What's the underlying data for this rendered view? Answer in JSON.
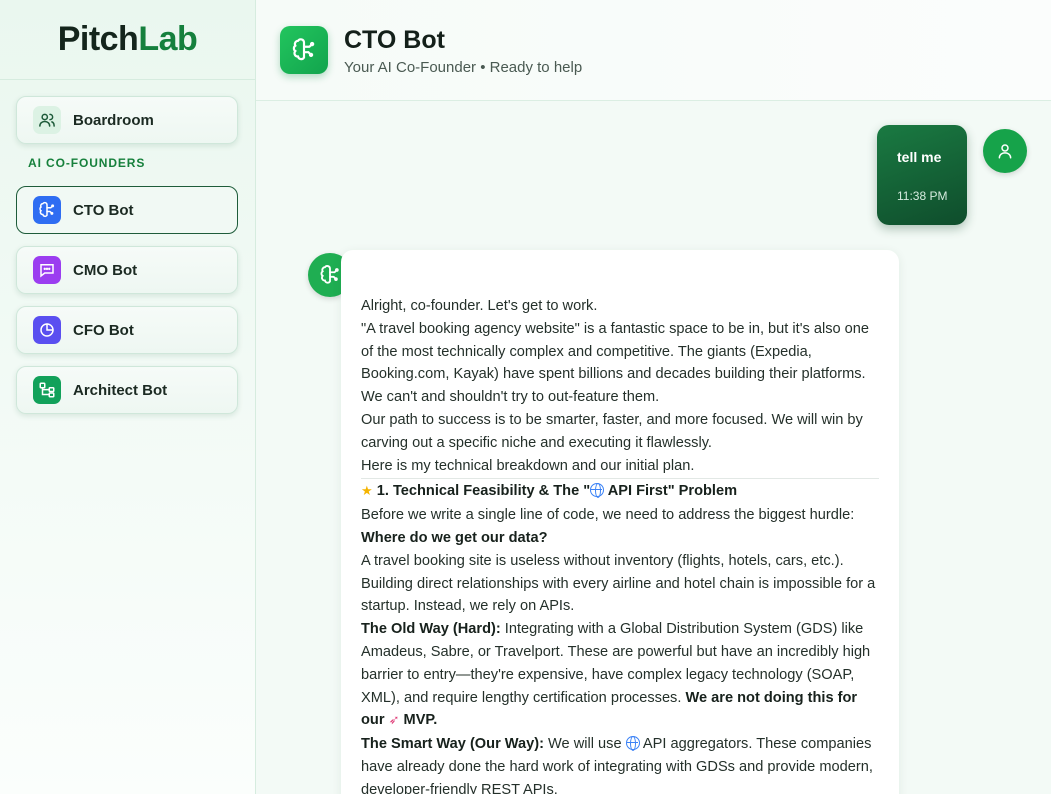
{
  "brand": {
    "part1": "Pitch",
    "part2": "Lab"
  },
  "sidebar": {
    "boardroom": {
      "label": "Boardroom"
    },
    "section_title": "AI CO-FOUNDERS",
    "bots": [
      {
        "label": "CTO Bot",
        "icon": "brain-icon",
        "color": "#2f6df2"
      },
      {
        "label": "CMO Bot",
        "icon": "chat-icon",
        "color": "#9b3df0"
      },
      {
        "label": "CFO Bot",
        "icon": "pie-chart-icon",
        "color": "#5a4ff0"
      },
      {
        "label": "Architect Bot",
        "icon": "diagram-icon",
        "color": "#12a15a"
      }
    ]
  },
  "header": {
    "title": "CTO Bot",
    "subtitle": "Your AI Co-Founder • Ready to help"
  },
  "chat": {
    "user_message": {
      "text": "tell me",
      "time": "11:38 PM"
    },
    "bot_message": {
      "p1": "Alright, co-founder. Let's get to work.",
      "p2": "\"A travel booking agency website\" is a fantastic space to be in, but it's also one of the most technically complex and competitive. The giants (Expedia, Booking.com, Kayak) have spent billions and decades building their platforms. We can't and shouldn't try to out-feature them.",
      "p3": "Our path to success is to be smarter, faster, and more focused. We will win by carving out a specific niche and executing it flawlessly.",
      "p4": "Here is my technical breakdown and our initial plan.",
      "h1_prefix": "1. Technical Feasibility & The \"",
      "h1_suffix": " API First\" Problem",
      "p5": "Before we write a single line of code, we need to address the biggest hurdle:",
      "p6": "Where do we get our data?",
      "p7": "A travel booking site is useless without inventory (flights, hotels, cars, etc.). Building direct relationships with every airline and hotel chain is impossible for a startup. Instead, we rely on APIs.",
      "old_way_label": "The Old Way (Hard):",
      "old_way_text": " Integrating with a Global Distribution System (GDS) like Amadeus, Sabre, or Travelport. These are powerful but have an incredibly high barrier to entry—they're expensive, have complex legacy technology (SOAP, XML), and require lengthy certification processes. ",
      "old_way_bold1": "We are not doing this for our ",
      "old_way_bold2": " MVP.",
      "smart_way_label": "The Smart Way (Our Way):",
      "smart_way_text1": " We will use ",
      "smart_way_text2": " API aggregators. These companies have already done the hard work of integrating with GDSs and provide modern, developer-friendly REST APIs."
    }
  }
}
